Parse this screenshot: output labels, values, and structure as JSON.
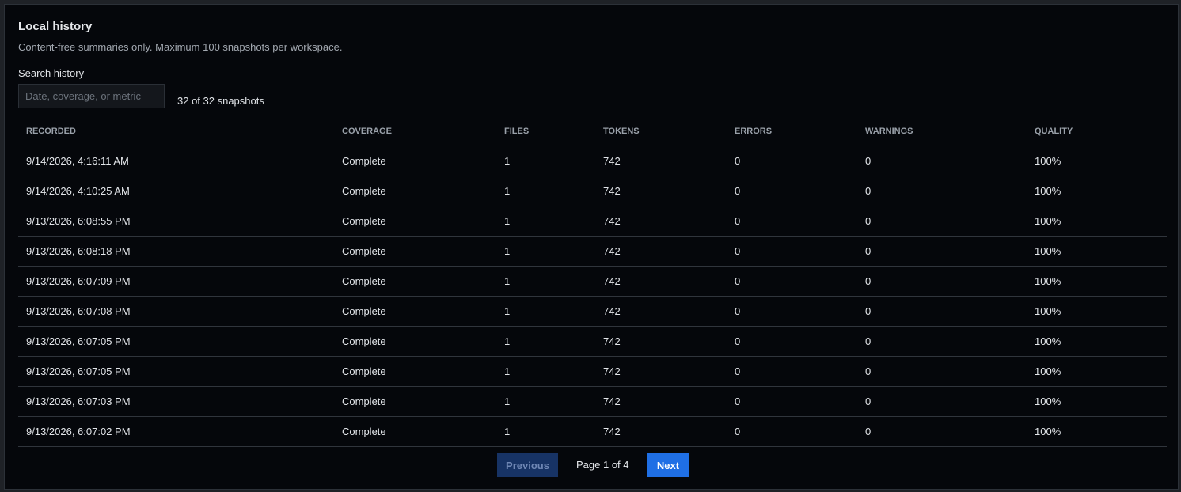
{
  "header": {
    "title": "Local history",
    "subtitle": "Content-free summaries only. Maximum 100 snapshots per workspace."
  },
  "search": {
    "label": "Search history",
    "placeholder": "Date, coverage, or metric",
    "value": "",
    "count_text": "32 of 32 snapshots"
  },
  "table": {
    "columns": [
      "RECORDED",
      "COVERAGE",
      "FILES",
      "TOKENS",
      "ERRORS",
      "WARNINGS",
      "QUALITY"
    ],
    "rows": [
      [
        "9/14/2026, 4:16:11 AM",
        "Complete",
        "1",
        "742",
        "0",
        "0",
        "100%"
      ],
      [
        "9/14/2026, 4:10:25 AM",
        "Complete",
        "1",
        "742",
        "0",
        "0",
        "100%"
      ],
      [
        "9/13/2026, 6:08:55 PM",
        "Complete",
        "1",
        "742",
        "0",
        "0",
        "100%"
      ],
      [
        "9/13/2026, 6:08:18 PM",
        "Complete",
        "1",
        "742",
        "0",
        "0",
        "100%"
      ],
      [
        "9/13/2026, 6:07:09 PM",
        "Complete",
        "1",
        "742",
        "0",
        "0",
        "100%"
      ],
      [
        "9/13/2026, 6:07:08 PM",
        "Complete",
        "1",
        "742",
        "0",
        "0",
        "100%"
      ],
      [
        "9/13/2026, 6:07:05 PM",
        "Complete",
        "1",
        "742",
        "0",
        "0",
        "100%"
      ],
      [
        "9/13/2026, 6:07:05 PM",
        "Complete",
        "1",
        "742",
        "0",
        "0",
        "100%"
      ],
      [
        "9/13/2026, 6:07:03 PM",
        "Complete",
        "1",
        "742",
        "0",
        "0",
        "100%"
      ],
      [
        "9/13/2026, 6:07:02 PM",
        "Complete",
        "1",
        "742",
        "0",
        "0",
        "100%"
      ]
    ]
  },
  "pagination": {
    "previous_label": "Previous",
    "page_text": "Page 1 of 4",
    "next_label": "Next",
    "previous_disabled": true
  },
  "colors": {
    "background": "#05070b",
    "accent": "#1f6fe5",
    "accent_disabled": "#173365"
  }
}
